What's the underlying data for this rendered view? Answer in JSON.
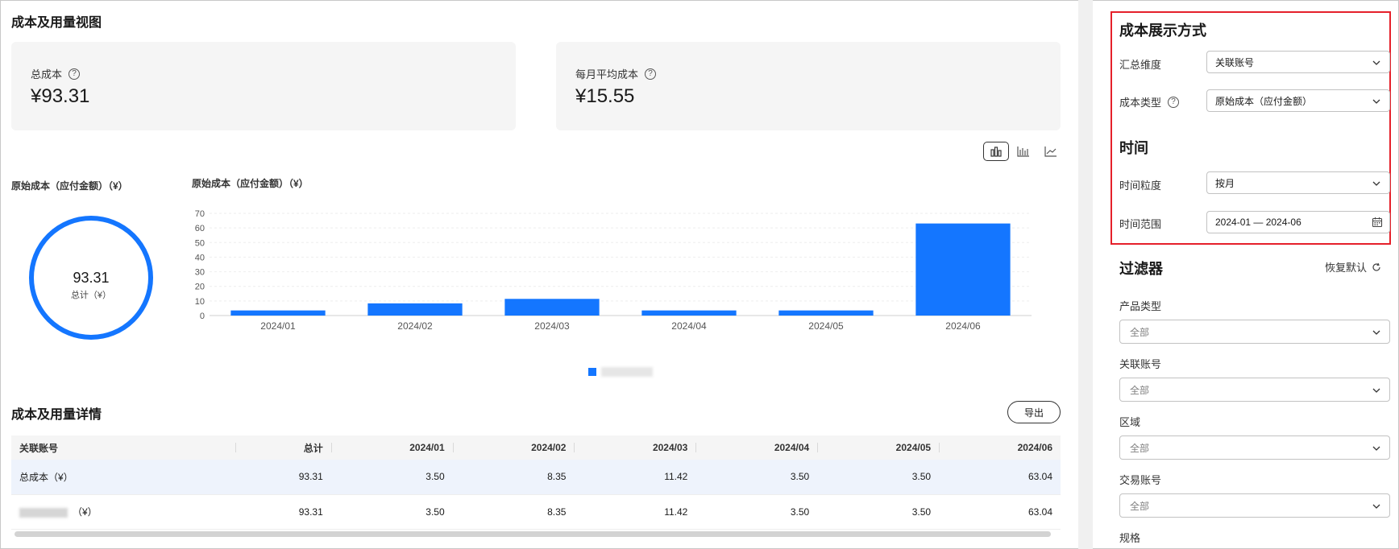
{
  "main": {
    "title": "成本及用量视图",
    "cards": [
      {
        "label": "总成本",
        "value": "¥93.31"
      },
      {
        "label": "每月平均成本",
        "value": "¥15.55"
      }
    ],
    "chart_toggle": [
      "bar-chart-icon",
      "stacked-bar-icon",
      "line-chart-icon"
    ],
    "donut": {
      "title": "原始成本（应付金额）（¥）",
      "value": "93.31",
      "sub": "总计（¥）",
      "color": "#1476ff"
    },
    "bar_title": "原始成本（应付金额）（¥）"
  },
  "chart_data": {
    "type": "bar",
    "title": "原始成本（应付金额）（¥）",
    "categories": [
      "2024/01",
      "2024/02",
      "2024/03",
      "2024/04",
      "2024/05",
      "2024/06"
    ],
    "values": [
      3.5,
      8.35,
      11.42,
      3.5,
      3.5,
      63.04
    ],
    "yticks": [
      0,
      10,
      20,
      30,
      40,
      50,
      60,
      70
    ],
    "ylim": [
      0,
      70
    ],
    "color": "#1476ff",
    "grid": true
  },
  "detail": {
    "title": "成本及用量详情",
    "export_label": "导出",
    "columns": [
      "关联账号",
      "总计",
      "2024/01",
      "2024/02",
      "2024/03",
      "2024/04",
      "2024/05",
      "2024/06"
    ],
    "rows": [
      {
        "name": "总成本（¥）",
        "values": [
          "93.31",
          "3.50",
          "8.35",
          "11.42",
          "3.50",
          "3.50",
          "63.04"
        ]
      },
      {
        "name": "（¥）",
        "values": [
          "93.31",
          "3.50",
          "8.35",
          "11.42",
          "3.50",
          "3.50",
          "63.04"
        ]
      }
    ]
  },
  "sidebar": {
    "display_heading": "成本展示方式",
    "summary_dim": {
      "label": "汇总维度",
      "value": "关联账号"
    },
    "cost_type": {
      "label": "成本类型",
      "value": "原始成本（应付金额）"
    },
    "time_heading": "时间",
    "granularity": {
      "label": "时间粒度",
      "value": "按月"
    },
    "range": {
      "label": "时间范围",
      "value": "2024-01 — 2024-06"
    },
    "filter_heading": "过滤器",
    "reset_label": "恢复默认",
    "filters": [
      {
        "label": "产品类型",
        "value": "全部"
      },
      {
        "label": "关联账号",
        "value": "全部"
      },
      {
        "label": "区域",
        "value": "全部"
      },
      {
        "label": "交易账号",
        "value": "全部"
      }
    ],
    "last_filter_label": "规格"
  },
  "colors": {
    "accent": "#1476ff",
    "highlight_border": "#e5202a"
  }
}
